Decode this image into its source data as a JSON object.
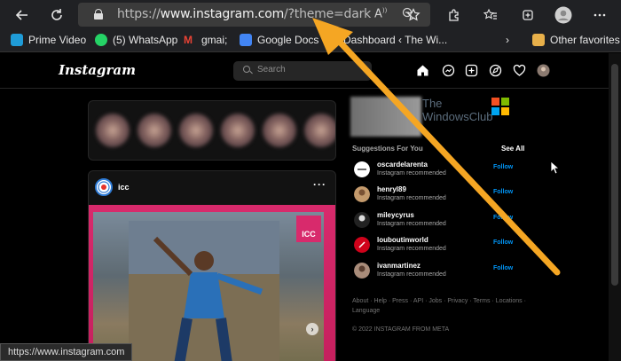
{
  "browser": {
    "url_prefix": "https://",
    "url_domain": "www.instagram.com",
    "url_path": "/?theme=dark",
    "bookmarks": [
      {
        "label": "Prime Video",
        "color": "#1f9cd8"
      },
      {
        "label": "(5) WhatsApp",
        "color": "#25d366"
      },
      {
        "label": "gmai;",
        "color": "#ea4335"
      },
      {
        "label": "Google Docs",
        "color": "#4285f4"
      },
      {
        "label": "Dashboard ‹ The Wi...",
        "color": "#3b3b3b"
      },
      {
        "label": "Other favorites",
        "color": "#e8b04a"
      }
    ]
  },
  "instagram": {
    "logo": "Instagram",
    "search_placeholder": "Search",
    "post": {
      "username": "icc",
      "badge": "ICC"
    },
    "watermark": [
      "The",
      "WindowsClub"
    ],
    "suggestions_title": "Suggestions For You",
    "see_all": "See All",
    "suggestions": [
      {
        "name": "oscardelarenta",
        "sub": "Instagram recommended",
        "action": "Follow"
      },
      {
        "name": "henryl89",
        "sub": "Instagram recommended",
        "action": "Follow"
      },
      {
        "name": "mileycyrus",
        "sub": "Instagram recommended",
        "action": "Follow"
      },
      {
        "name": "louboutinworld",
        "sub": "Instagram recommended",
        "action": "Follow"
      },
      {
        "name": "ivanmartinez",
        "sub": "Instagram recommended",
        "action": "Follow"
      }
    ],
    "footer_links": "About · Help · Press · API · Jobs · Privacy · Terms · Locations · Language",
    "copyright": "© 2022 INSTAGRAM FROM META"
  },
  "status_bar": "https://www.instagram.com",
  "colors": {
    "accent_arrow": "#f5a623",
    "follow": "#0095f6",
    "post_frame": "#d82a6c"
  }
}
